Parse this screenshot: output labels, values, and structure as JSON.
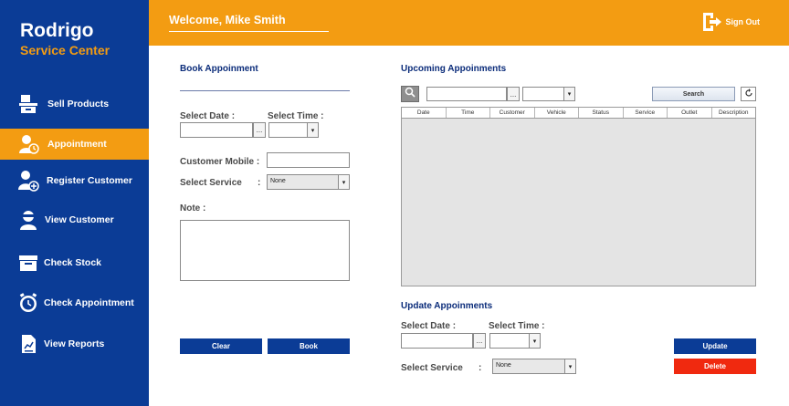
{
  "brand": {
    "line1": "Rodrigo",
    "line2": "Service Center"
  },
  "header": {
    "welcome": "Welcome, Mike Smith",
    "signout": "Sign Out"
  },
  "sidebar": {
    "items": [
      {
        "label": "Sell Products",
        "icon": "sell-products-icon"
      },
      {
        "label": "Appointment",
        "icon": "appointment-icon",
        "active": true
      },
      {
        "label": "Register Customer",
        "icon": "register-customer-icon"
      },
      {
        "label": "View Customer",
        "icon": "view-customer-icon"
      },
      {
        "label": "Check Stock",
        "icon": "check-stock-icon"
      },
      {
        "label": "Check Appointment",
        "icon": "check-appointment-icon"
      },
      {
        "label": "View Reports",
        "icon": "view-reports-icon"
      }
    ]
  },
  "book": {
    "title": "Book Appoinment",
    "select_date": "Select Date :",
    "select_time": "Select Time :",
    "date_btn": "...",
    "customer_mobile": "Customer Mobile :",
    "select_service": "Select Service",
    "colon": ":",
    "service_value": "None",
    "note": "Note :",
    "clear": "Clear",
    "book": "Book"
  },
  "upcoming": {
    "title": "Upcoming Appoinments",
    "dots_btn": "...",
    "search": "Search",
    "columns": [
      "Date",
      "Time",
      "Customer",
      "Vehicle",
      "Status",
      "Service",
      "Outlet",
      "Description"
    ]
  },
  "update": {
    "title": "Update Appoinments",
    "select_date": "Select Date :",
    "select_time": "Select Time :",
    "date_btn": "...",
    "select_service": "Select Service",
    "colon": ":",
    "service_value": "None",
    "update": "Update",
    "delete": "Delete"
  },
  "colors": {
    "sidebar": "#0b3c96",
    "accent": "#f39c12",
    "delete": "#f0290f"
  }
}
